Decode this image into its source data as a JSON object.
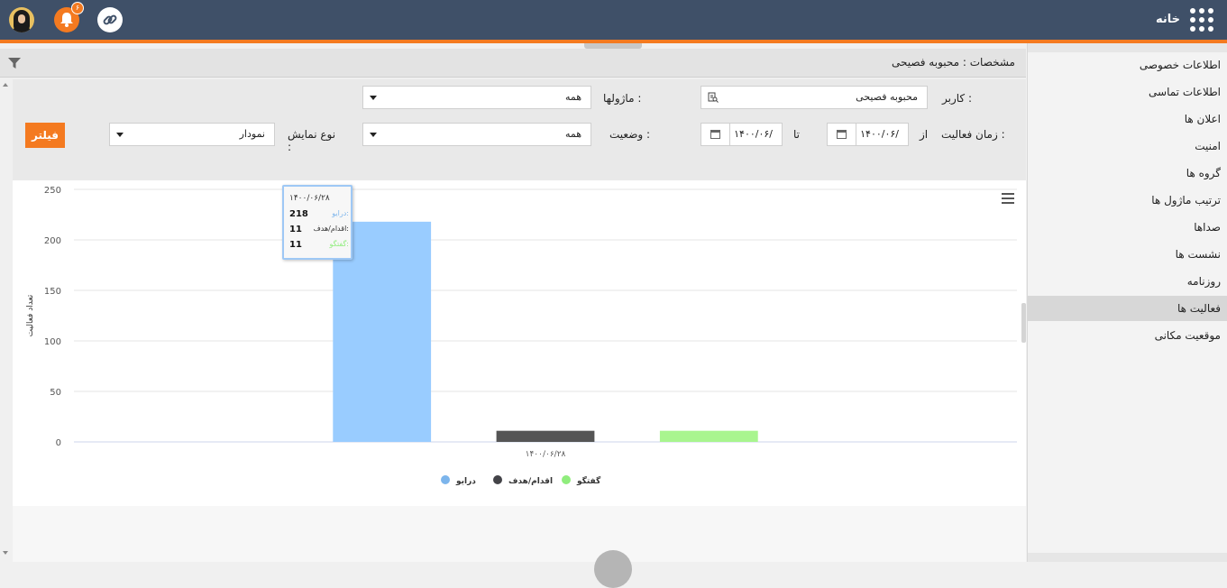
{
  "topbar": {
    "home_label": "خانه",
    "notification_count": "۶"
  },
  "header": {
    "title": "مشخصات : محبوبه فصیحی"
  },
  "filters": {
    "user_label": "کاربر :",
    "user_value": "محبوبه فصیحی",
    "modules_label": "ماژولها :",
    "modules_value": "همه",
    "activity_time_label": "زمان فعالیت :",
    "from_label": "از",
    "from_value": "۱۴۰۰/۰۶/",
    "to_label": "تا",
    "to_value": "۱۴۰۰/۰۶/",
    "status_label": "وضعیت :",
    "status_value": "همه",
    "display_type_label": "نوع نمایش",
    "display_type_colon": ":",
    "display_type_value": "نمودار",
    "filter_button": "فیلتر"
  },
  "sidebar": {
    "items": [
      {
        "label": "اطلاعات خصوصی",
        "active": false
      },
      {
        "label": "اطلاعات تماسی",
        "active": false
      },
      {
        "label": "اعلان ها",
        "active": false
      },
      {
        "label": "امنیت",
        "active": false
      },
      {
        "label": "گروه ها",
        "active": false
      },
      {
        "label": "ترتیب ماژول ها",
        "active": false
      },
      {
        "label": "صداها",
        "active": false
      },
      {
        "label": "نشست ها",
        "active": false
      },
      {
        "label": "روزنامه",
        "active": false
      },
      {
        "label": "فعالیت ها",
        "active": true
      },
      {
        "label": "موقعیت مکانی",
        "active": false
      }
    ]
  },
  "tooltip": {
    "date": "۱۴۰۰/۰۶/۲۸",
    "rows": [
      {
        "value": "218",
        "label": "درایو:",
        "color": "#7cb5ec"
      },
      {
        "value": "11",
        "label": "اقدام/هدف:",
        "color": "#333333"
      },
      {
        "value": "11",
        "label": "گفتگو:",
        "color": "#90ed7d"
      }
    ]
  },
  "chart_data": {
    "type": "bar",
    "categories": [
      "۱۴۰۰/۰۶/۲۸"
    ],
    "series": [
      {
        "name": "درایو",
        "values": [
          218
        ],
        "color": "#99ccff",
        "legend_color": "#7cb5ec"
      },
      {
        "name": "اقدام/هدف",
        "values": [
          11
        ],
        "color": "#555555",
        "legend_color": "#434348"
      },
      {
        "name": "گفتگو",
        "values": [
          11
        ],
        "color": "#a9f58f",
        "legend_color": "#90ed7d"
      }
    ],
    "ylabel": "تعداد فعالیت",
    "ylim": [
      0,
      250
    ],
    "yticks": [
      "0",
      "50",
      "100",
      "150",
      "200",
      "250"
    ],
    "grid": true,
    "legend_position": "bottom"
  }
}
